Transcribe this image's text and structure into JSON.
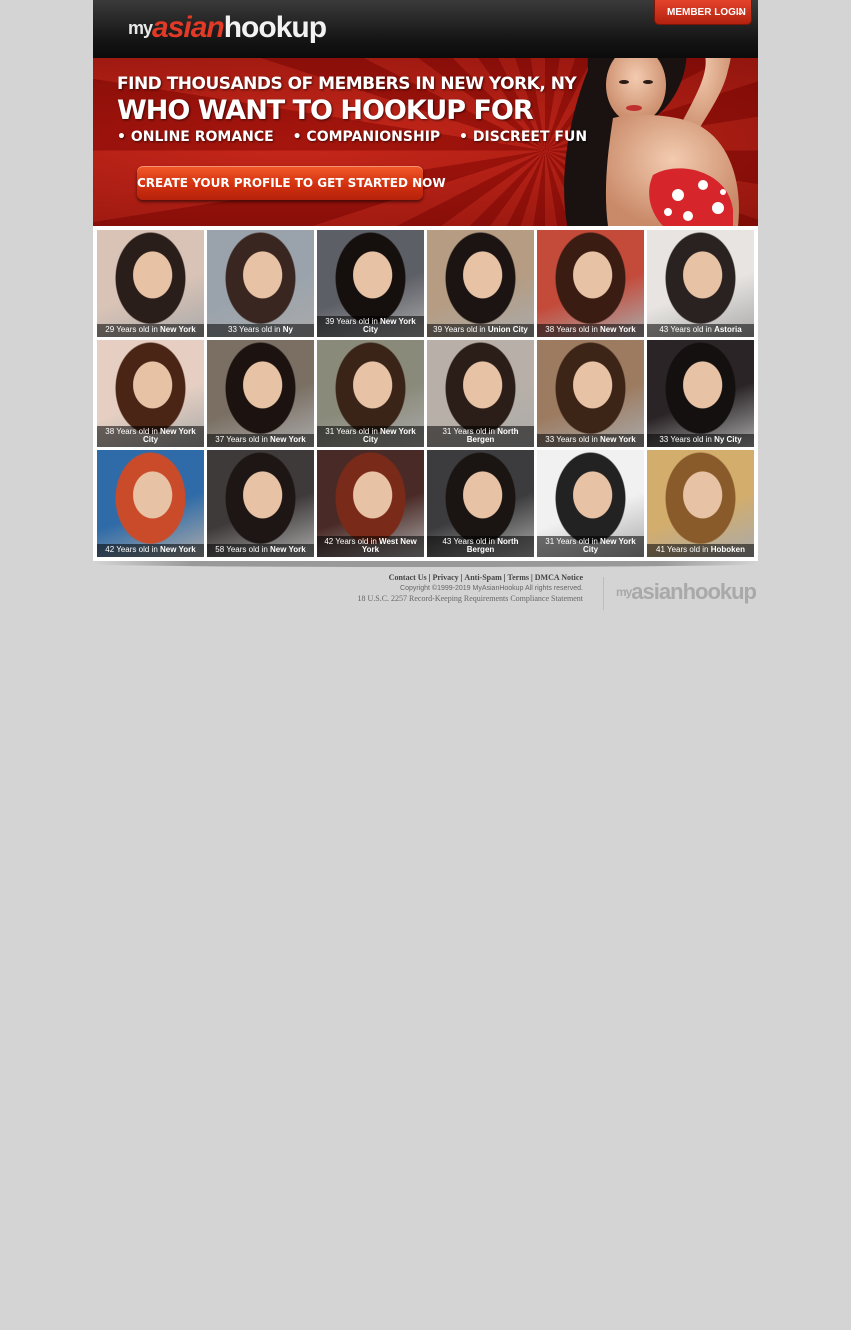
{
  "brand": {
    "logo_my": "my",
    "logo_asian": "asian",
    "logo_hookup": "hookup"
  },
  "header": {
    "login_label": "MEMBER LOGIN",
    "login_caret": "⌄"
  },
  "banner": {
    "line1": "FIND THOUSANDS OF MEMBERS IN NEW YORK, NY",
    "line2": "WHO WANT TO HOOKUP FOR",
    "bullets": [
      "• ONLINE ROMANCE",
      "• COMPANIONSHIP",
      "• DISCREET FUN"
    ],
    "cta_label": "CREATE YOUR PROFILE TO GET STARTED NOW"
  },
  "members": [
    {
      "age": "29 Years old in ",
      "city": "New York"
    },
    {
      "age": "33 Years old in ",
      "city": "Ny"
    },
    {
      "age": "39 Years old in ",
      "city": "New York City"
    },
    {
      "age": "39 Years old in ",
      "city": "Union City"
    },
    {
      "age": "38 Years old in ",
      "city": "New York"
    },
    {
      "age": "43 Years old in ",
      "city": "Astoria"
    },
    {
      "age": "38 Years old in ",
      "city": "New York City"
    },
    {
      "age": "37 Years old in ",
      "city": "New York"
    },
    {
      "age": "31 Years old in ",
      "city": "New York City"
    },
    {
      "age": "31 Years old in ",
      "city": "North Bergen"
    },
    {
      "age": "33 Years old in ",
      "city": "New York"
    },
    {
      "age": "33 Years old in ",
      "city": "Ny City"
    },
    {
      "age": "42 Years old in ",
      "city": "New York"
    },
    {
      "age": "58 Years old in ",
      "city": "New York"
    },
    {
      "age": "42 Years old in ",
      "city": "West New York"
    },
    {
      "age": "43 Years old in ",
      "city": "North Bergen"
    },
    {
      "age": "31 Years old in ",
      "city": "New York City"
    },
    {
      "age": "41 Years old in ",
      "city": "Hoboken"
    }
  ],
  "footer": {
    "links": [
      "Contact Us",
      "Privacy",
      "Anti-Spam",
      "Terms",
      "DMCA Notice"
    ],
    "separator": "|",
    "copyright": "Copyright ©1999-2019 MyAsianHookup All rights reserved.",
    "legal": "18 U.S.C. 2257 Record-Keeping Requirements Compliance Statement"
  }
}
